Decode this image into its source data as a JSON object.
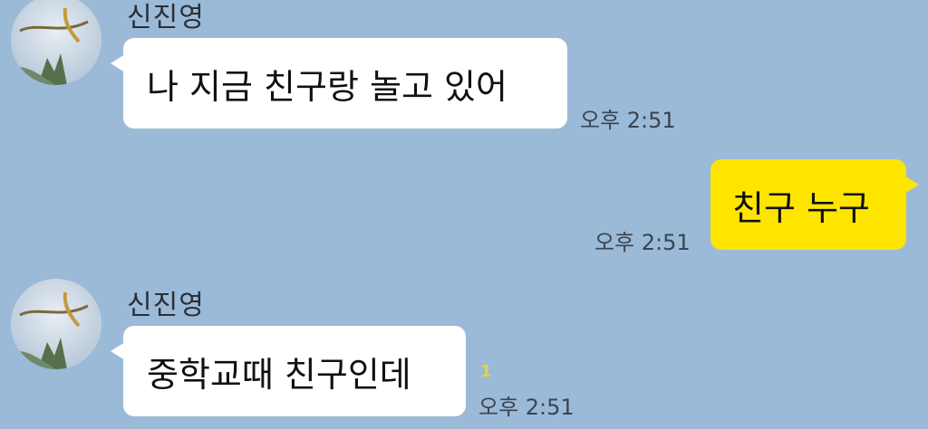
{
  "chat": {
    "messages": [
      {
        "sender": "신진영",
        "text": "나 지금 친구랑 놀고 있어",
        "time": "오후 2:51",
        "direction": "incoming"
      },
      {
        "text": "친구 누구",
        "time": "오후 2:51",
        "direction": "outgoing"
      },
      {
        "sender": "신진영",
        "text": "중학교때 친구인데",
        "time": "오후 2:51",
        "unread": "1",
        "direction": "incoming"
      }
    ]
  },
  "colors": {
    "background": "#9bbad8",
    "incoming_bubble": "#ffffff",
    "outgoing_bubble": "#fee500",
    "unread": "#e5d33a"
  },
  "icons": {
    "avatar": "profile-avatar-icon"
  }
}
